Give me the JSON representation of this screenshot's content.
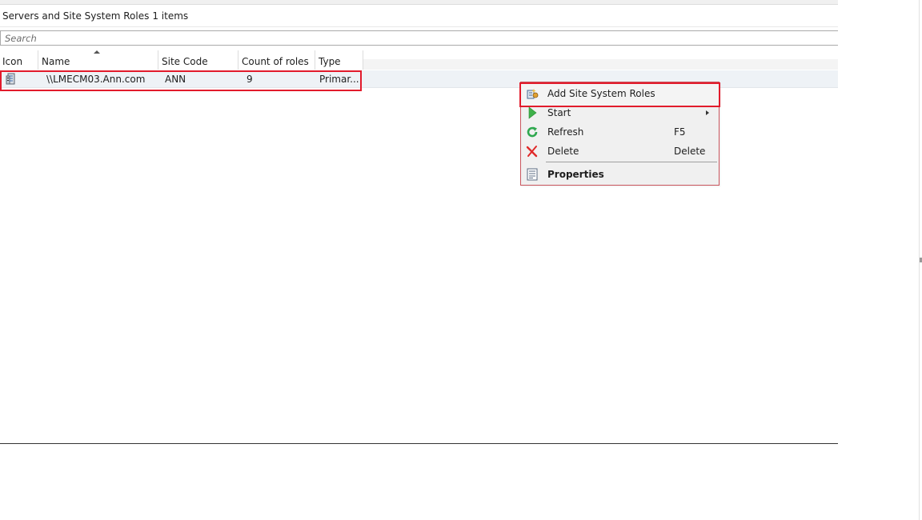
{
  "header": {
    "title": "Servers and Site System Roles",
    "count": "1 items"
  },
  "search": {
    "placeholder": "Search",
    "value": ""
  },
  "table": {
    "columns": [
      "Icon",
      "Name",
      "Site Code",
      "Count of roles",
      "Type"
    ],
    "sort": {
      "column": "Name",
      "direction": "ascending"
    },
    "rows": [
      {
        "icon": "server-icon",
        "name": "\\\\LMECM03.Ann.com",
        "site_code": "ANN",
        "count_of_roles": "9",
        "type": "Primar..."
      }
    ]
  },
  "context_menu": {
    "items": [
      {
        "label": "Add Site System Roles",
        "icon": "add-site-system-roles-icon",
        "shortcut": "",
        "submenu": false
      },
      {
        "label": "Start",
        "icon": "play-icon",
        "shortcut": "",
        "submenu": true
      },
      {
        "label": "Refresh",
        "icon": "refresh-icon",
        "shortcut": "F5",
        "submenu": false
      },
      {
        "label": "Delete",
        "icon": "delete-icon",
        "shortcut": "Delete",
        "submenu": false
      },
      {
        "label": "Properties",
        "icon": "properties-icon",
        "shortcut": "",
        "submenu": false
      }
    ]
  },
  "colors": {
    "highlight_border": "#e21b2c",
    "menu_background": "#f0f0f0",
    "row_background": "#eef2f6"
  }
}
